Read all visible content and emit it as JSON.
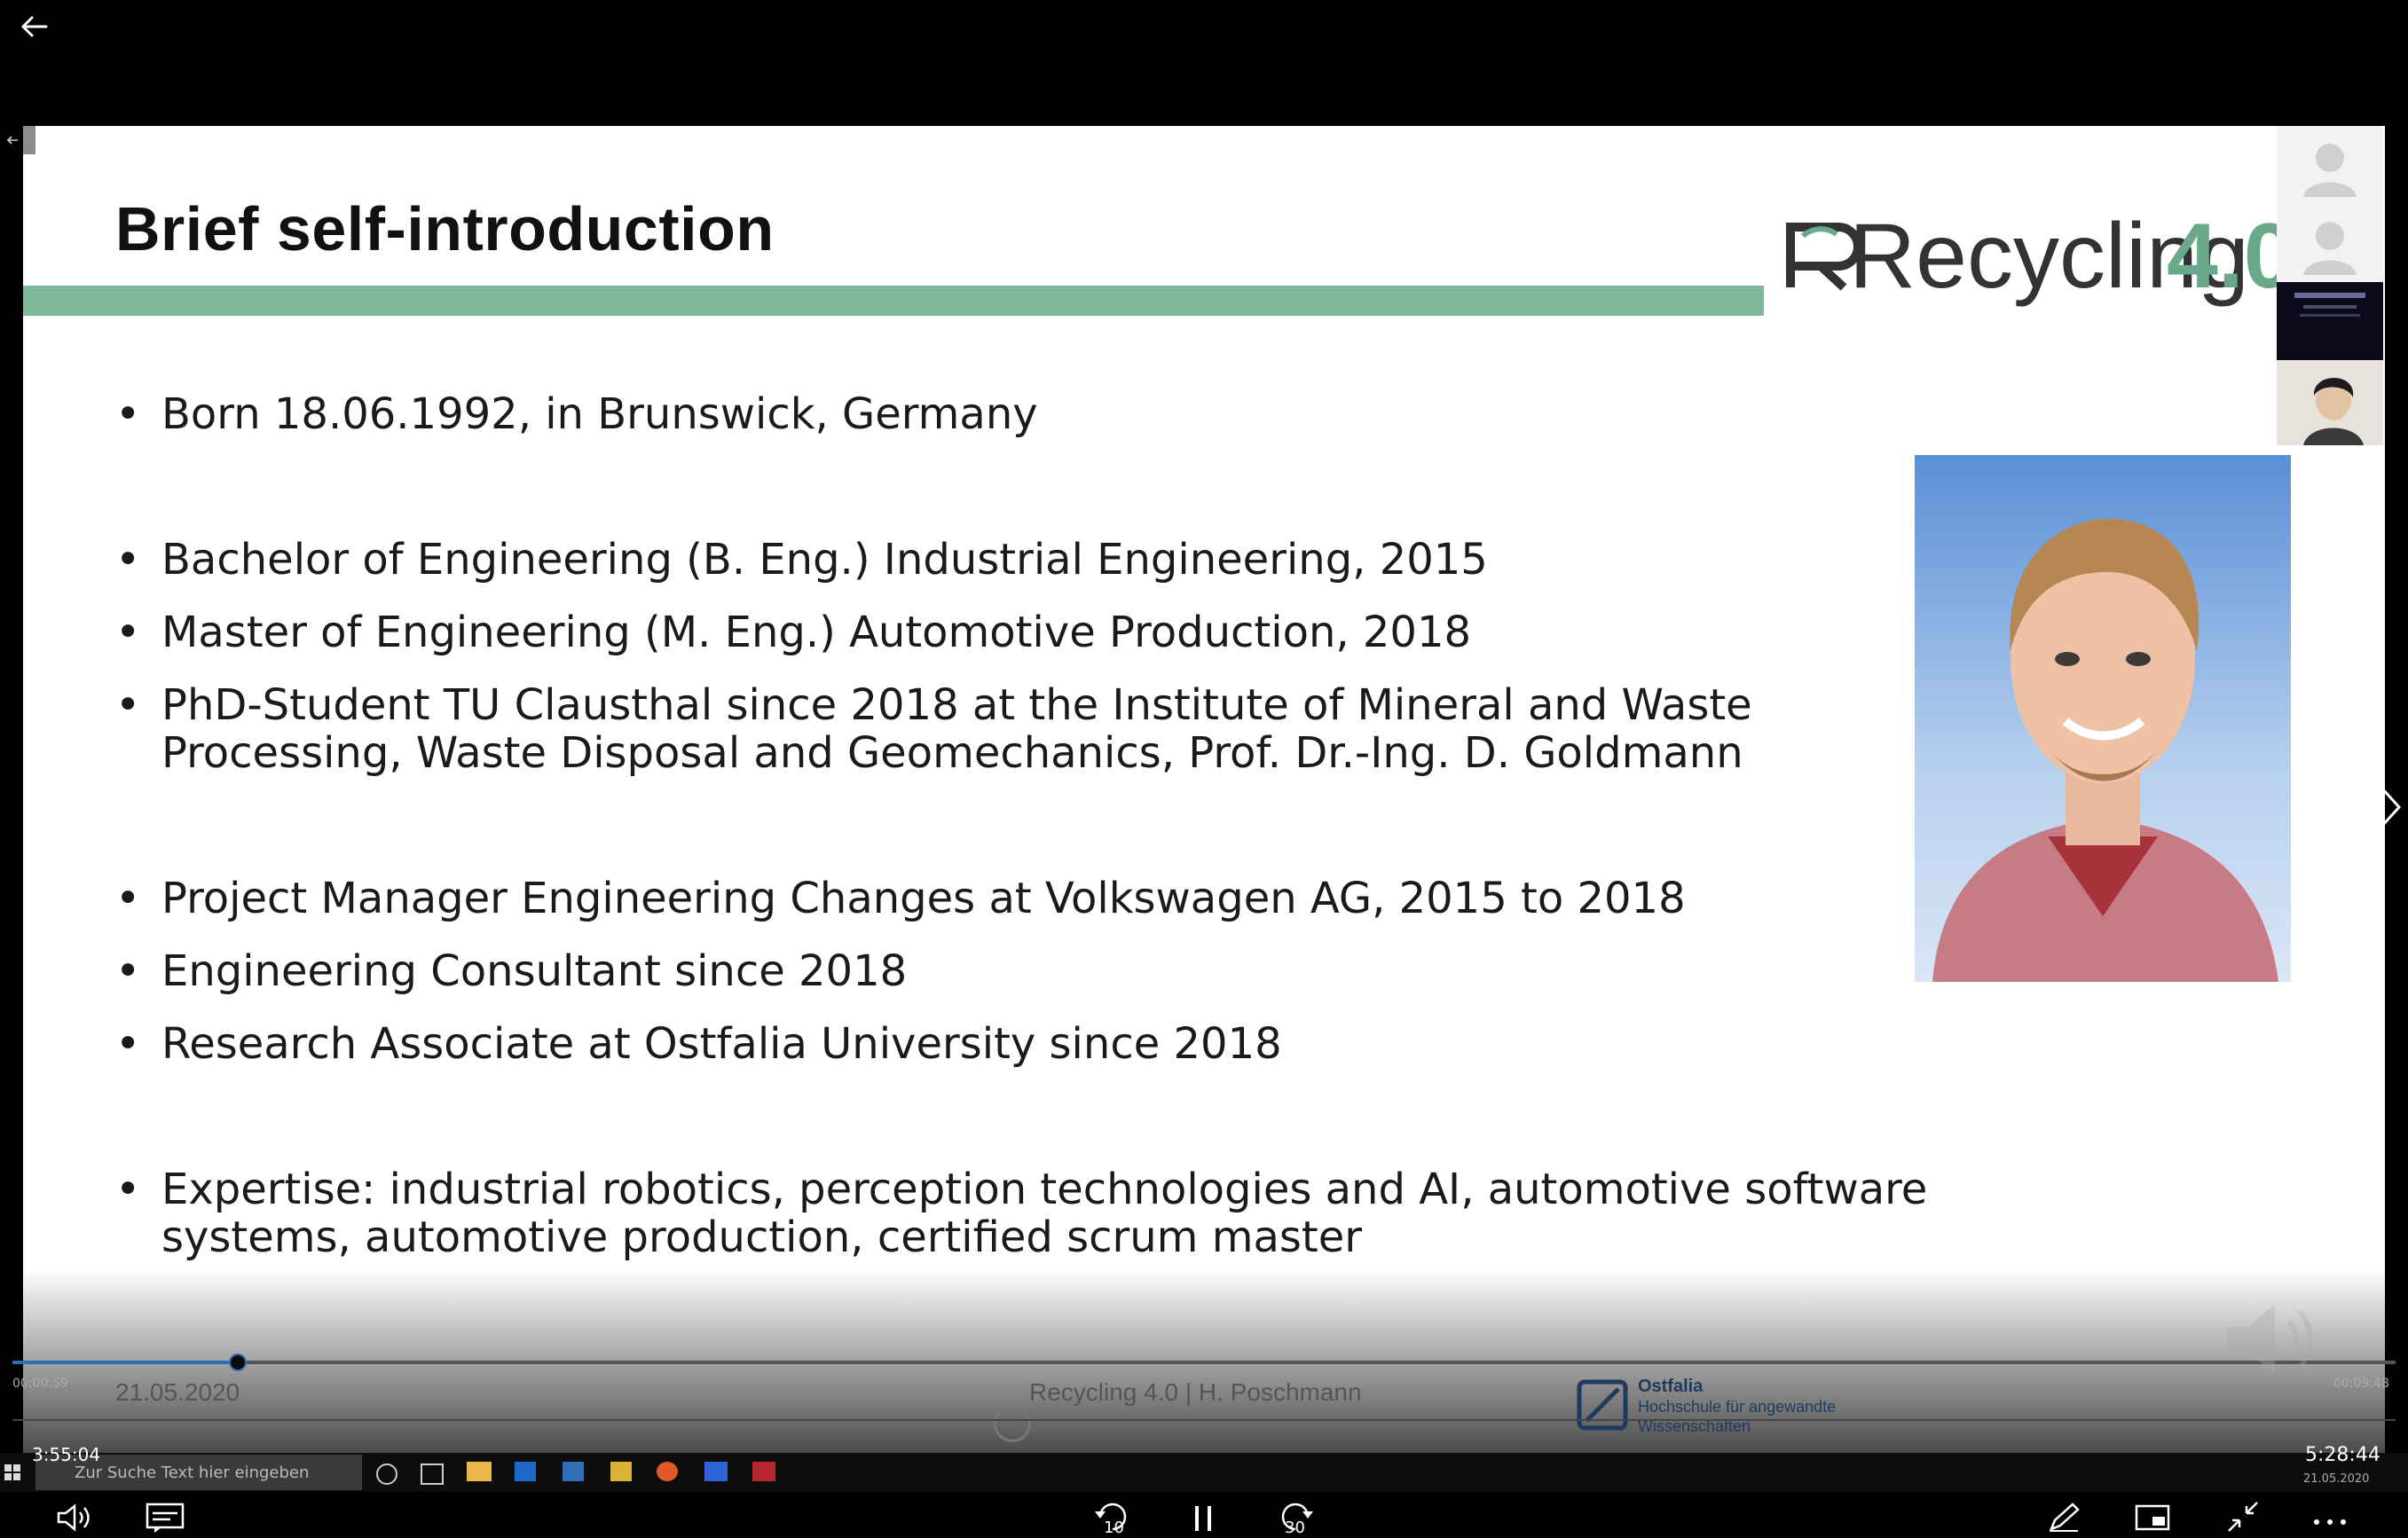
{
  "slide": {
    "title": "Brief self-introduction",
    "logo": {
      "word": "Recycling",
      "version": "4.0"
    },
    "bullets": [
      "Born 18.06.1992, in Brunswick, Germany",
      "Bachelor of Engineering (B. Eng.) Industrial Engineering, 2015",
      "Master of Engineering (M. Eng.) Automotive Production, 2018",
      "PhD-Student TU Clausthal since 2018 at the Institute of Mineral and Waste",
      "Processing, Waste Disposal and Geomechanics, Prof. Dr.-Ing. D. Goldmann",
      "Project Manager Engineering Changes at Volkswagen AG, 2015 to 2018",
      "Engineering Consultant since 2018",
      "Research Associate at Ostfalia University since 2018",
      "Expertise: industrial robotics, perception technologies and AI, automotive software",
      "systems, automotive production, certified scrum master"
    ],
    "footer": {
      "date": "21.05.2020",
      "center": "Recycling 4.0 | H. Poschmann",
      "org_name": "Ostfalia",
      "org_sub1": "Hochschule für angewandte",
      "org_sub2": "Wissenschaften"
    }
  },
  "inner_player": {
    "elapsed": "00:00:59",
    "total": "00:09:48",
    "progress_fraction": 0.094
  },
  "taskbar": {
    "search_placeholder": "Zur Suche Text hier eingeben",
    "clock_left": "3:55:04",
    "clock_right": "5:28:44",
    "date_right": "21.05.2020"
  },
  "colors": {
    "accent_green": "#7eb89a",
    "progress_blue": "#2d6fb7",
    "background": "#000000"
  },
  "icons": {
    "back": "arrow-left-icon",
    "volume": "volume-icon",
    "captions": "captions-icon",
    "rewind": "rewind-10-icon",
    "pause": "pause-icon",
    "forward": "forward-30-icon",
    "pen": "pen-icon",
    "miniplayer": "miniplayer-icon",
    "exit_fullscreen": "exit-fullscreen-icon",
    "more": "more-icon",
    "next": "chevron-right-icon"
  },
  "bottom_controls": {
    "rewind_label": "10",
    "forward_label": "30"
  }
}
